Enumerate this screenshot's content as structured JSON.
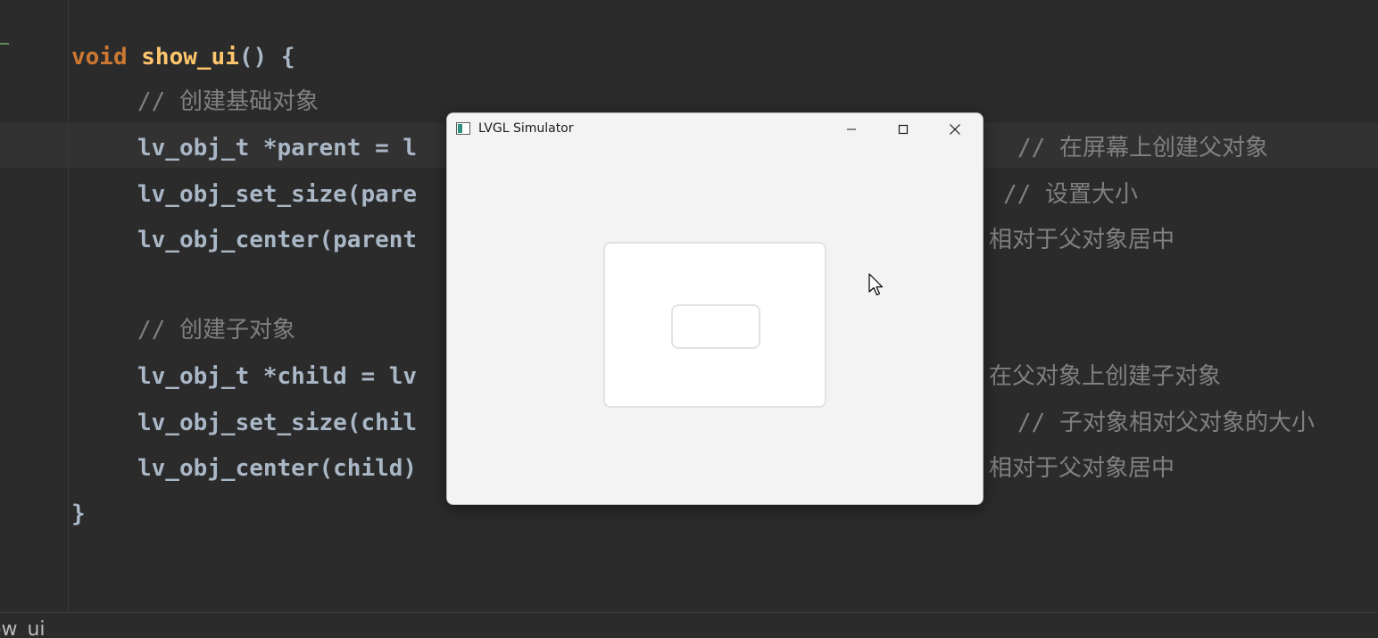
{
  "editor": {
    "lines": [
      {
        "keyword": "void",
        "function": "show_ui",
        "rest": "() {"
      },
      {
        "comment": "// 创建基础对象"
      },
      {
        "code": "lv_obj_t *parent = l",
        "comment": "// 在屏幕上创建父对象"
      },
      {
        "code": "lv_obj_set_size(pare",
        "comment": "// 设置大小"
      },
      {
        "code": "lv_obj_center(parent",
        "comment": "相对于父对象居中"
      },
      {
        "comment": "// 创建子对象"
      },
      {
        "code": "lv_obj_t *child = lv",
        "comment": "在父对象上创建子对象"
      },
      {
        "code": "lv_obj_set_size(chil",
        "comment": "// 子对象相对父对象的大小"
      },
      {
        "code": "lv_obj_center(child)",
        "comment": "相对于父对象居中"
      },
      {
        "code": "}"
      }
    ]
  },
  "statusbar": {
    "breadcrumb": "ow_ui"
  },
  "simulator": {
    "title": "LVGL Simulator",
    "buttons": {
      "minimize": "minimize-icon",
      "maximize": "maximize-icon",
      "close": "close-icon"
    }
  },
  "colors": {
    "editor_bg": "#2b2b2b",
    "keyword": "#cc7832",
    "function": "#ffc66d",
    "code": "#a9b7c6",
    "comment": "#808080",
    "window_bg": "#f3f3f3"
  }
}
